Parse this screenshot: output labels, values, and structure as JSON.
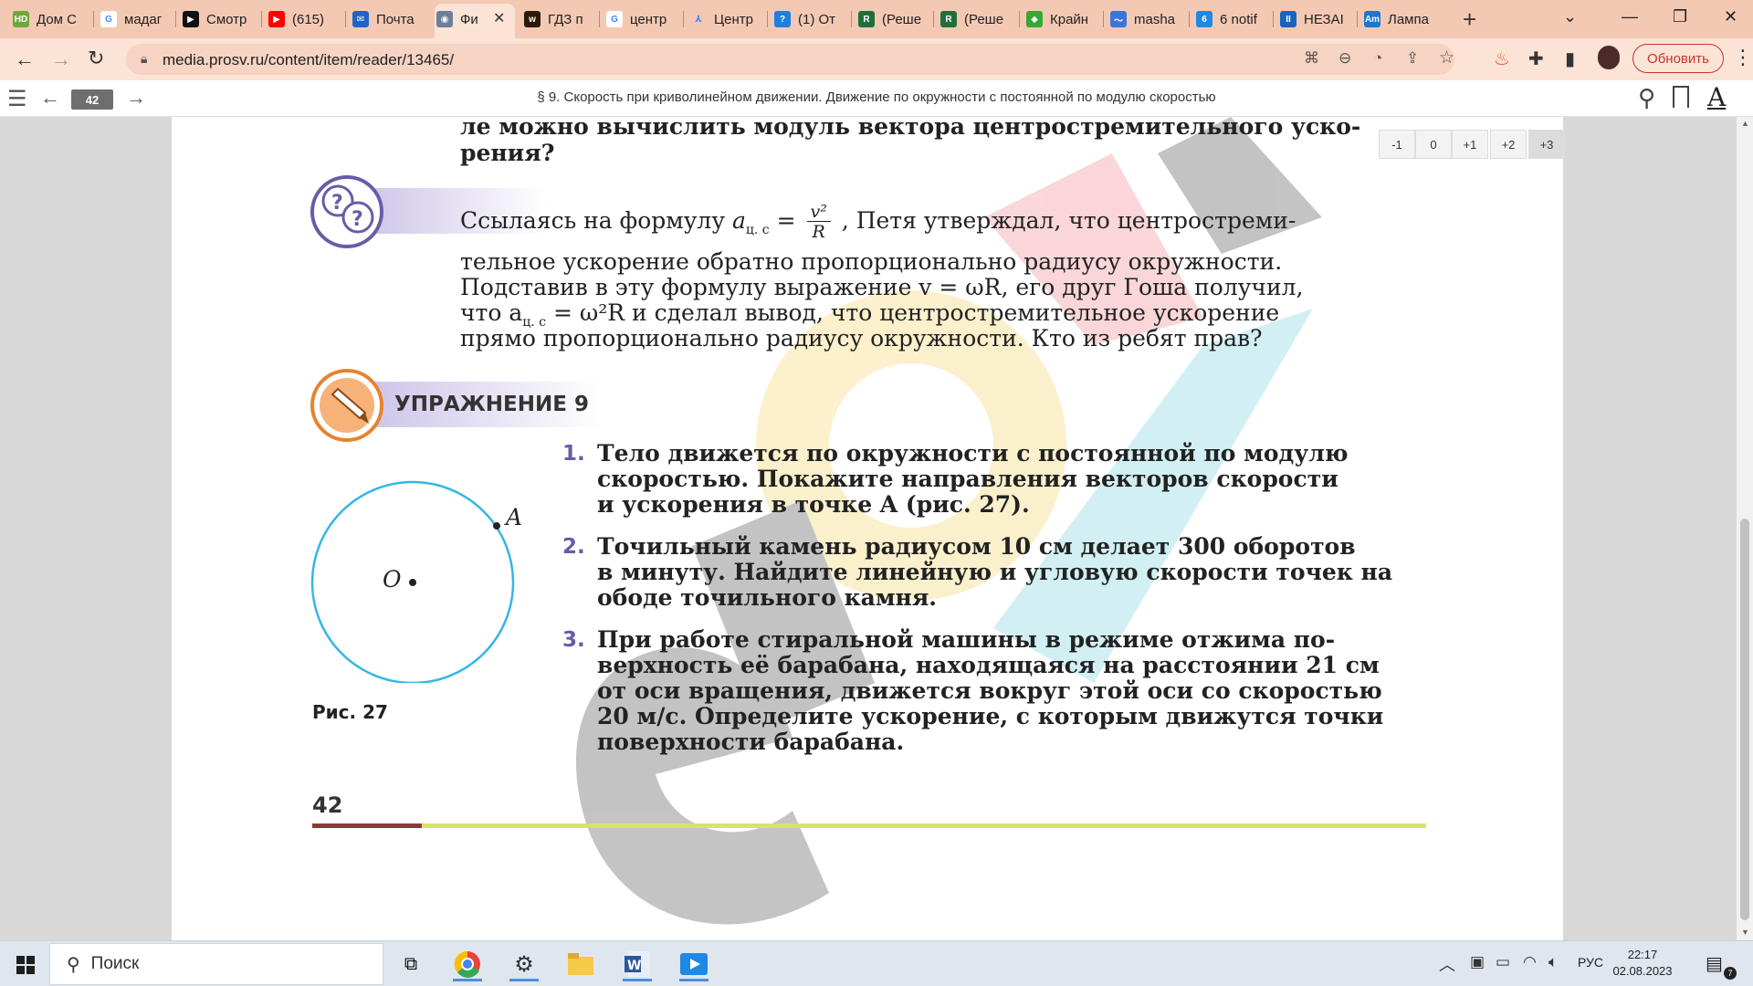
{
  "browser": {
    "tabs": [
      {
        "label": "Дом С",
        "fav_color": "#6fa83a",
        "fav_text": "HD"
      },
      {
        "label": "мадаг",
        "fav_color": "#ffffff",
        "fav_text": "G"
      },
      {
        "label": "Смотр",
        "fav_color": "#111111",
        "fav_text": "▶"
      },
      {
        "label": "(615) ",
        "fav_color": "#ff0000",
        "fav_text": "▶"
      },
      {
        "label": "Почта",
        "fav_color": "#1e64c8",
        "fav_text": "✉"
      },
      {
        "label": "Фи",
        "fav_color": "#6b7f99",
        "fav_text": "◉"
      },
      {
        "label": "ГДЗ п",
        "fav_color": "#2b1a0a",
        "fav_text": "w"
      },
      {
        "label": "центр",
        "fav_color": "#ffffff",
        "fav_text": "G"
      },
      {
        "label": "Центр",
        "fav_color": "#f3c9b4",
        "fav_text": "⅄"
      },
      {
        "label": "(1) От",
        "fav_color": "#1e7fe0",
        "fav_text": "?"
      },
      {
        "label": "(Реше",
        "fav_color": "#1f6f3e",
        "fav_text": "R"
      },
      {
        "label": "(Реше",
        "fav_color": "#1f6f3e",
        "fav_text": "R"
      },
      {
        "label": "Крайн",
        "fav_color": "#33aa33",
        "fav_text": "◆"
      },
      {
        "label": "masha",
        "fav_color": "#3a76d9",
        "fav_text": "〜"
      },
      {
        "label": "6 notif",
        "fav_color": "#1e88e5",
        "fav_text": "6"
      },
      {
        "label": "НЕЗАІ",
        "fav_color": "#1565c0",
        "fav_text": "II"
      },
      {
        "label": "Лампа",
        "fav_color": "#1976d2",
        "fav_text": "Am"
      }
    ],
    "url": "media.prosv.ru/content/item/reader/13465/",
    "update_label": "Обновить"
  },
  "reader": {
    "page_badge": "42",
    "chapter_title": "§ 9. Скорость при криволинейном движении. Движение по окружности с постоянной по модулю скоростью",
    "zoom_levels": [
      "-1",
      "0",
      "+1",
      "+2",
      "+3"
    ]
  },
  "book": {
    "top_line1": "ле можно вычислить модуль вектора центростремительного уско-",
    "top_line2": "рения?",
    "q_line1_a": "Ссылаясь на формулу ",
    "q_formula_a": "a",
    "q_formula_sub": "ц. с",
    "q_formula_eq": "=",
    "q_formula_num": "v²",
    "q_formula_den": "R",
    "q_line1_b": ", Петя утверждал, что центростреми-",
    "q_line2": "тельное ускорение обратно пропорционально радиусу окружности.",
    "q_line3": "Подставив в эту формулу выражение v = ωR, его друг Гоша получил,",
    "q_line4_a": "что a",
    "q_line4_sub": "ц. с",
    "q_line4_b": " = ω²R и сделал вывод, что центростремительное ускорение",
    "q_line5": "прямо пропорционально радиусу окружности. Кто из ребят прав?",
    "exercise_title": "УПРАЖНЕНИЕ 9",
    "items": [
      {
        "num": "1.",
        "lines": [
          "Тело движется по окружности с постоянной по модулю",
          "скоростью. Покажите направления векторов скорости",
          "и ускорения в точке A (рис. 27)."
        ]
      },
      {
        "num": "2.",
        "lines": [
          "Точильный камень радиусом 10 см делает 300 оборотов",
          "в минуту. Найдите линейную и угловую скорости точек на",
          "ободе точильного камня."
        ]
      },
      {
        "num": "3.",
        "lines": [
          "При работе стиральной машины в режиме отжима по-",
          "верхность её барабана, находящаяся на расстоянии 21 см",
          "от оси вращения, движется вокруг этой оси со скоростью",
          "20 м/с. Определите ускорение, с которым движутся точки",
          "поверхности барабана."
        ]
      }
    ],
    "figure_point_a": "A",
    "figure_point_o": "O",
    "figure_caption": "Рис. 27",
    "page_number": "42"
  },
  "taskbar": {
    "search_placeholder": "Поиск",
    "lang": "РУС",
    "time": "22:17",
    "date": "02.08.2023",
    "notif_count": "7"
  },
  "colors": {
    "tabstrip": "#f3c9b4",
    "toolbar": "#fbe3d6",
    "accent_purple": "#6a5ba8",
    "circle": "#35b6e6"
  }
}
